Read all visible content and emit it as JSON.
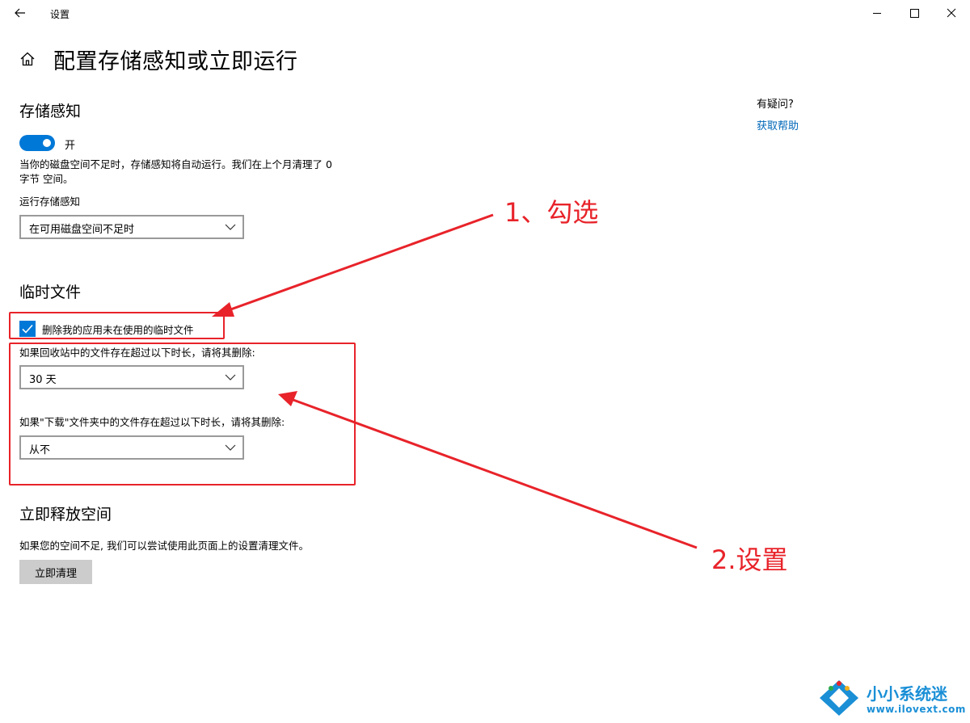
{
  "window": {
    "title": "设置"
  },
  "page": {
    "title": "配置存储感知或立即运行"
  },
  "storage_sense": {
    "heading": "存储感知",
    "toggle_state_label": "开",
    "toggle_on": true,
    "description_line1": "当你的磁盘空间不足时，存储感知将自动运行。我们在上个月清理了 0",
    "description_line2": "字节 空间。",
    "run_label": "运行存储感知",
    "run_value": "在可用磁盘空间不足时"
  },
  "temp_files": {
    "heading": "临时文件",
    "checkbox_label": "删除我的应用未在使用的临时文件",
    "checkbox_checked": true,
    "recycle_label": "如果回收站中的文件存在超过以下时长，请将其删除:",
    "recycle_value": "30 天",
    "downloads_label": "如果\"下载\"文件夹中的文件存在超过以下时长，请将其删除:",
    "downloads_value": "从不"
  },
  "free_now": {
    "heading": "立即释放空间",
    "description": "如果您的空间不足, 我们可以尝试使用此页面上的设置清理文件。",
    "button_label": "立即清理"
  },
  "help": {
    "title": "有疑问?",
    "link": "获取帮助"
  },
  "annotations": {
    "step1": "1、勾选",
    "step2": "2.设置",
    "color": "#e8232a"
  },
  "watermark": {
    "name": "小小系统迷",
    "url": "www.ilovext.com"
  },
  "accent_color": "#0078d7"
}
